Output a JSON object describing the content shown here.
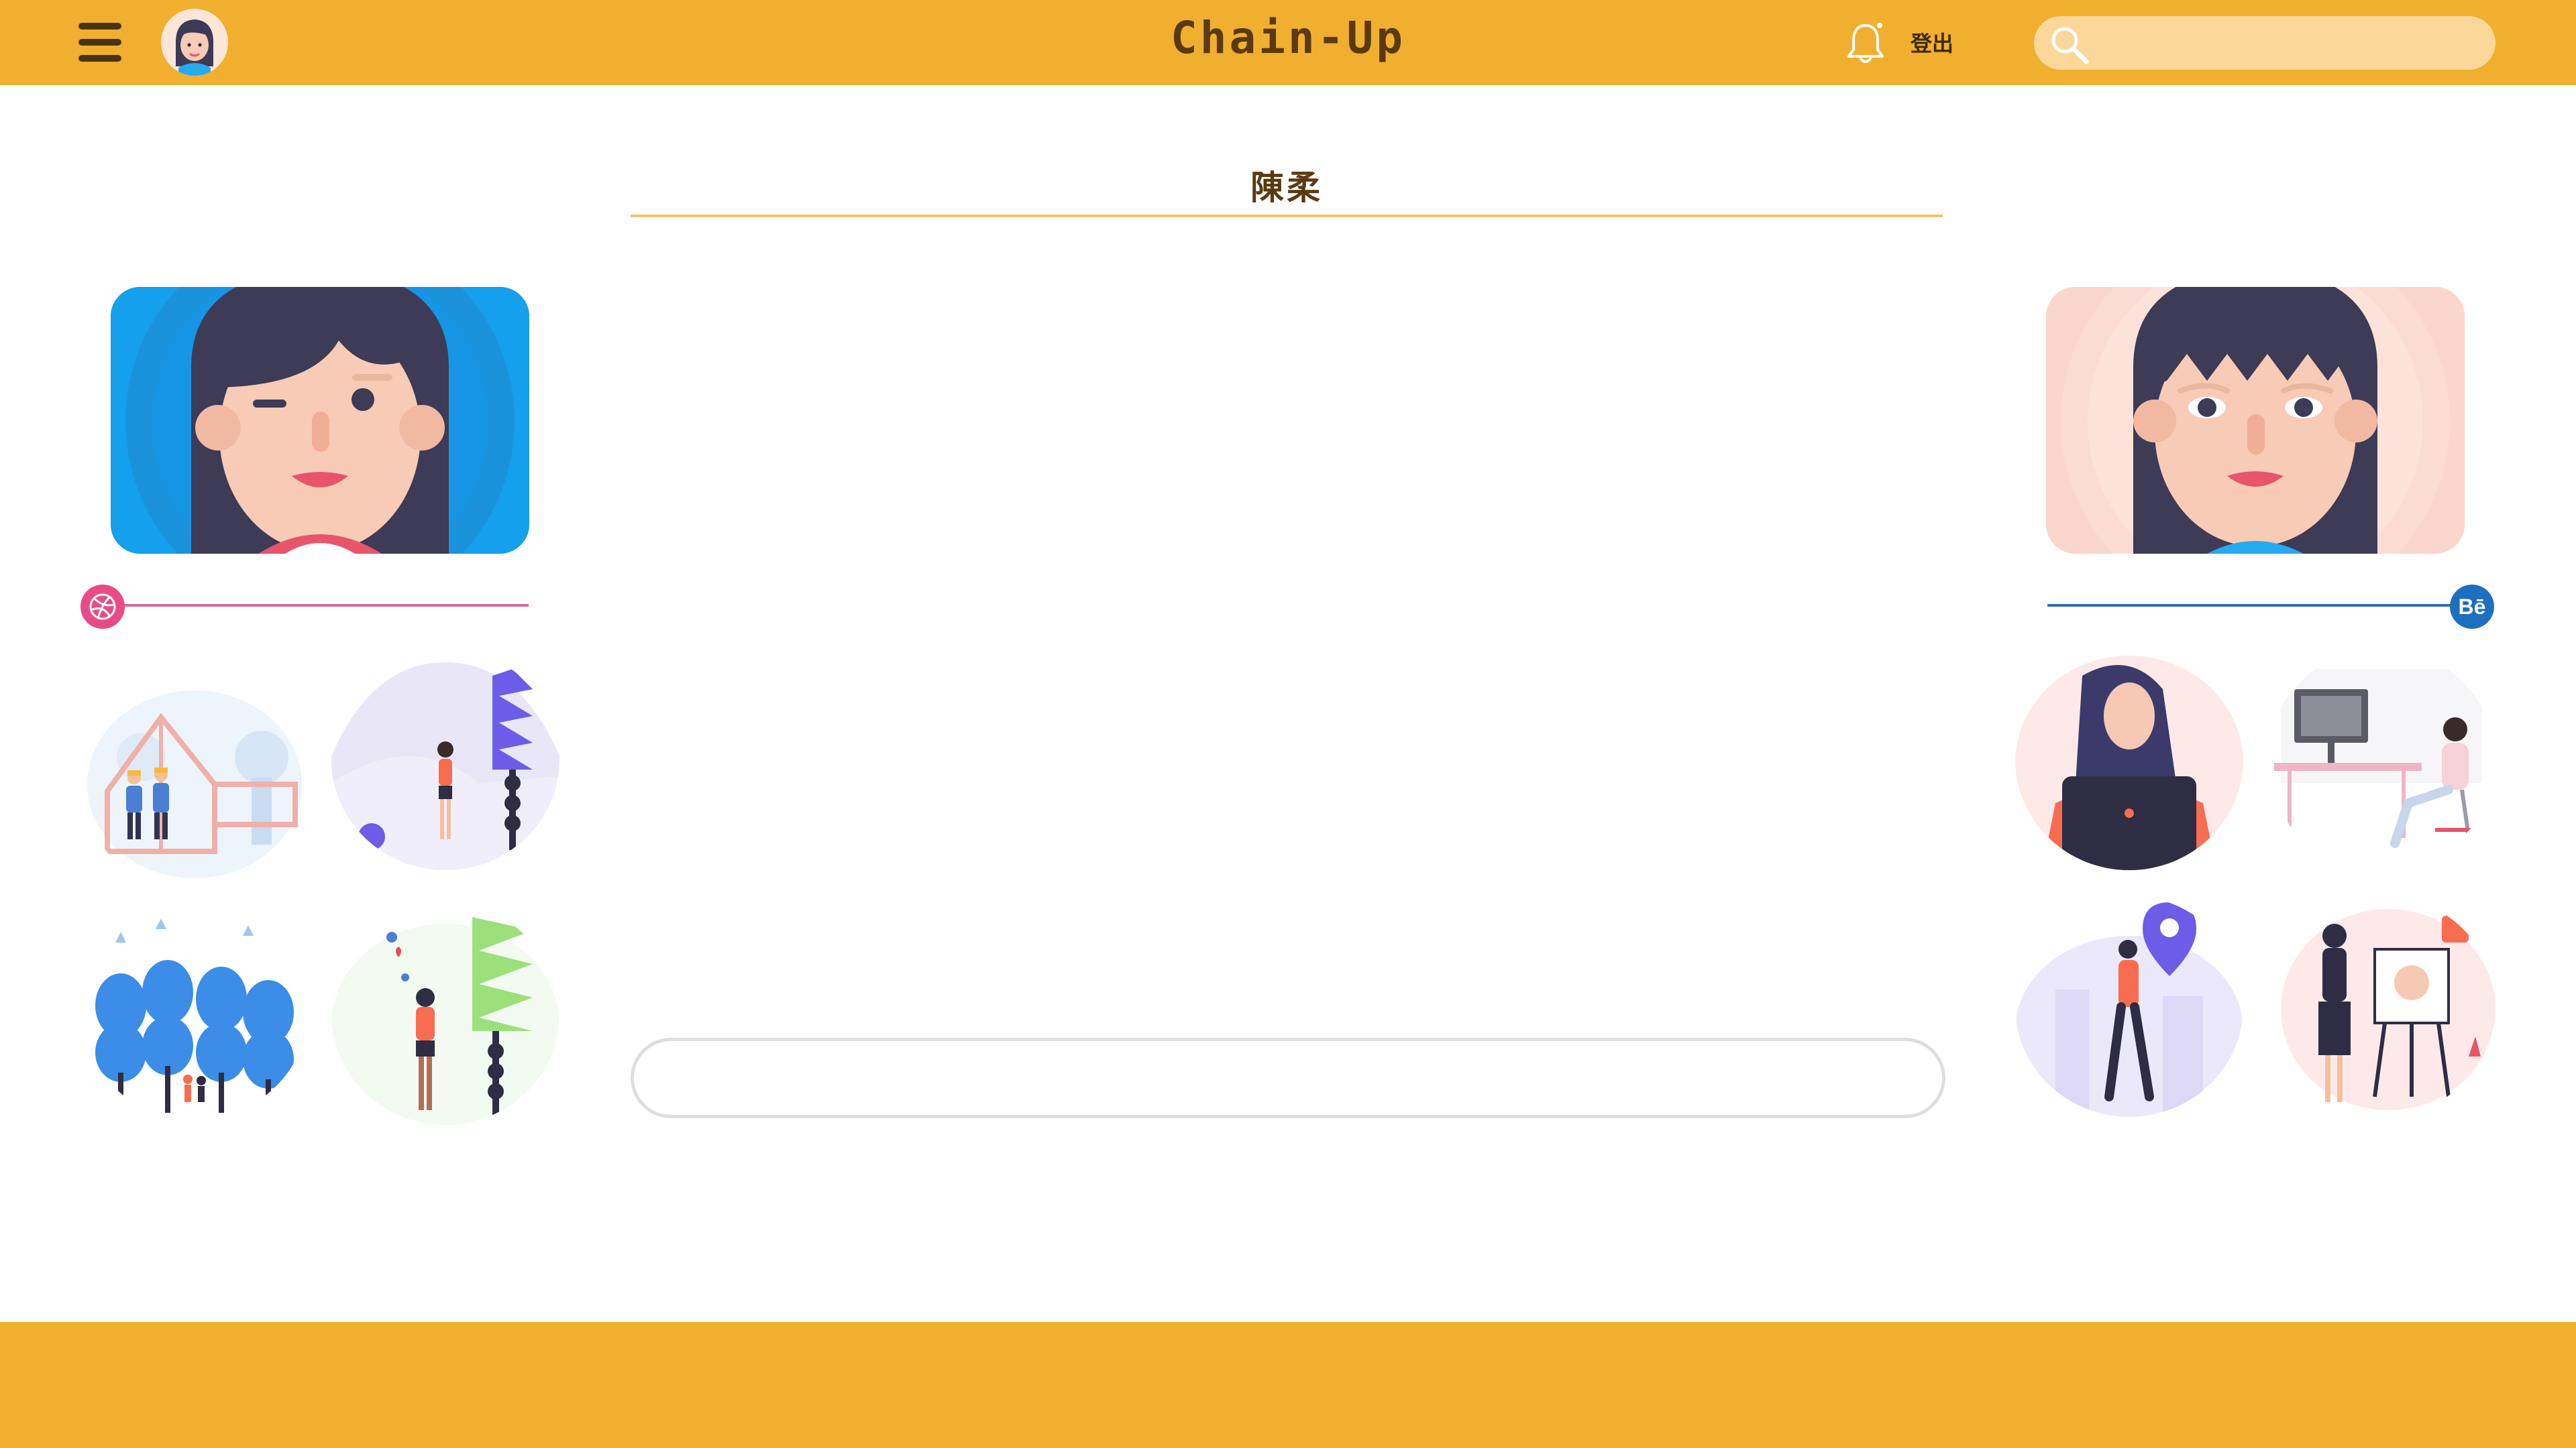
{
  "app": {
    "logo_text": "Chain-Up",
    "accent_color": "#f1af2f",
    "text_color": "#5a3a10"
  },
  "header": {
    "logout_label": "登出",
    "search_placeholder": "",
    "icons": [
      "hamburger-menu-icon",
      "user-avatar",
      "bell-icon",
      "search-icon"
    ]
  },
  "profile": {
    "name": "陳柔"
  },
  "cards": [
    {
      "id": "winking-avatar",
      "background": "#14a0ec"
    },
    {
      "id": "smiling-avatar",
      "background": "#fbd6cc"
    }
  ],
  "social": {
    "left": {
      "name": "dribbble",
      "color": "#e84b88",
      "icon": "dribbble-icon"
    },
    "right": {
      "name": "behance",
      "color": "#1d6fbf",
      "icon_text": "Bē"
    }
  },
  "illustrations": {
    "left": [
      "house-builders",
      "woman-walking-purple-tree",
      "people-blue-trees",
      "woman-phone-green-tree"
    ],
    "right": [
      "woman-laptop",
      "woman-desk-computer",
      "woman-location-pin",
      "woman-painting-easel"
    ]
  },
  "message": {
    "value": "",
    "placeholder": ""
  }
}
